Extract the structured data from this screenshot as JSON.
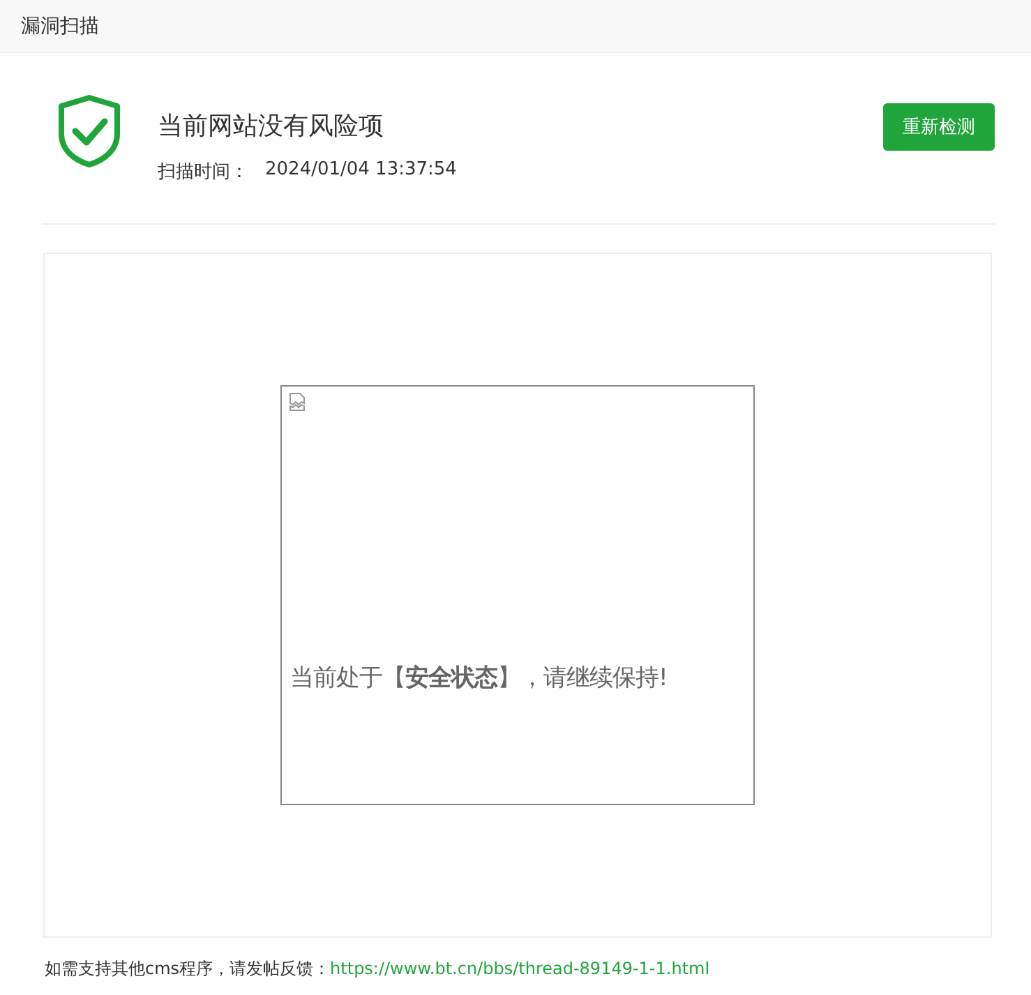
{
  "window": {
    "title": "漏洞扫描"
  },
  "result": {
    "safe": true,
    "message": "当前网站没有风险项",
    "scan_time_label": "扫描时间：",
    "scan_time": "2024/01/04 13:37:54",
    "button": "重新检测"
  },
  "preview": {
    "alt_text": "当前处于【**安全状态**】，请继续保持!"
  },
  "footer": {
    "note": "如需支持其他cms程序，请发帖反馈：",
    "link": "https://www.bt.cn/bbs/thread-89149-1-1.html"
  }
}
